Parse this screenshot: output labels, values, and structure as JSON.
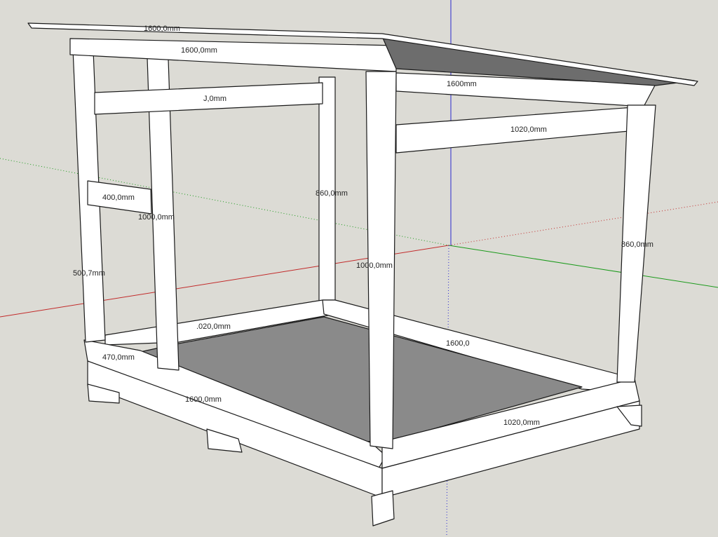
{
  "colors": {
    "background": "#dcdbd5",
    "wood": "#ffffff",
    "edge": "#1a1a1a",
    "floor": "#8a8a8a",
    "roof_underside": "#6d6d6d",
    "axis_red": "#c22a2a",
    "axis_green": "#1a9a1a",
    "axis_blue": "#2a2ad0"
  },
  "dimensions": {
    "roof_front": "1600,0mm",
    "front_top_beam": "1600,0mm",
    "side_top_beam": "1600mm",
    "back_crossbar": "J,0mm",
    "side_crossbar": "1020,0mm",
    "window_top": "400,0mm",
    "left_post_inner": "1000,0mm",
    "rear_post": "860,0mm",
    "window_side": "500,7mm",
    "front_right_post": "1000,0mm",
    "right_post": "860,0mm",
    "back_floor_edge": ".020,0mm",
    "right_floor_edge": "1600,0",
    "door_gap": "470,0mm",
    "front_base": "1600,0mm",
    "right_base": "1020,0mm"
  }
}
